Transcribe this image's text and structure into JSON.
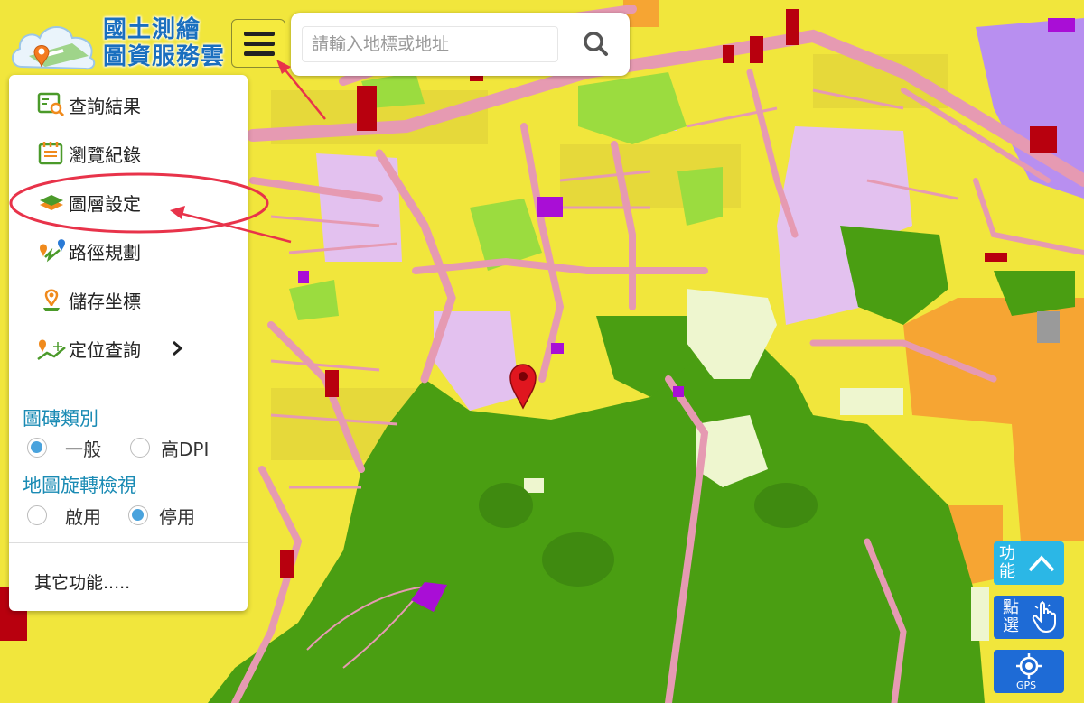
{
  "brand": {
    "line1": "國土測繪",
    "line2": "圖資服務雲"
  },
  "search": {
    "placeholder": "請輸入地標或地址"
  },
  "menu": {
    "items": [
      {
        "label": "查詢結果",
        "icon": "search-result-icon"
      },
      {
        "label": "瀏覽紀錄",
        "icon": "history-icon"
      },
      {
        "label": "圖層設定",
        "icon": "layers-icon"
      },
      {
        "label": "路徑規劃",
        "icon": "route-icon"
      },
      {
        "label": "儲存坐標",
        "icon": "save-pin-icon"
      },
      {
        "label": "定位查詢",
        "icon": "locate-icon"
      }
    ],
    "tile_section": {
      "title": "圖磚類別",
      "opt1": "一般",
      "opt2": "高DPI",
      "selected": "一般"
    },
    "rotate_section": {
      "title": "地圖旋轉檢視",
      "opt1": "啟用",
      "opt2": "停用",
      "selected": "停用"
    },
    "other": "其它功能....."
  },
  "buttons": {
    "func_line1": "功",
    "func_line2": "能",
    "select_line1": "點",
    "select_line2": "選",
    "gps": "GPS"
  },
  "colors": {
    "accent": "#1a8bb4",
    "brand_blue": "#1a6fbf",
    "annotation_red": "#e8334a",
    "fab_cyan": "#2bb7e6",
    "fab_blue": "#1e6bd6"
  }
}
